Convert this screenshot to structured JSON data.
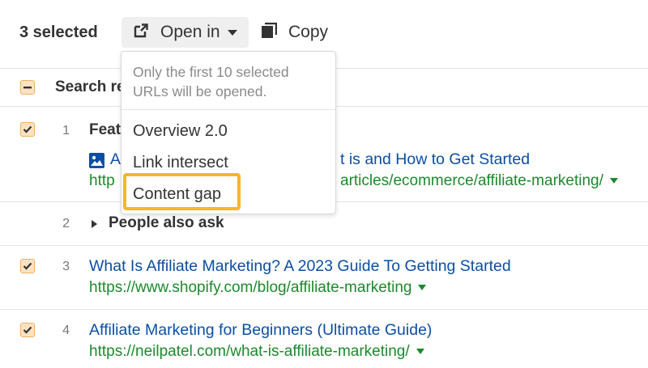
{
  "toolbar": {
    "selected_count": "3 selected",
    "open_in_label": "Open in",
    "copy_label": "Copy"
  },
  "table_header": {
    "column_label": "Search re"
  },
  "rows": [
    {
      "number": "1",
      "label": "Feat",
      "title_start": "A",
      "title_end": "t is and How to Get Started",
      "url_start": "http",
      "url_end": "articles/ecommerce/affiliate-marketing/",
      "checked": true
    },
    {
      "number": "2",
      "label": "People also ask",
      "checked": false
    },
    {
      "number": "3",
      "title": "What Is Affiliate Marketing? A 2023 Guide To Getting Started",
      "url": "https://www.shopify.com/blog/affiliate-marketing",
      "checked": true
    },
    {
      "number": "4",
      "title": "Affiliate Marketing for Beginners (Ultimate Guide)",
      "url": "https://neilpatel.com/what-is-affiliate-marketing/",
      "checked": true
    }
  ],
  "dropdown": {
    "note": "Only the first 10 selected URLs will be opened.",
    "items": [
      "Overview 2.0",
      "Link intersect",
      "Content gap"
    ],
    "highlighted": "Content gap"
  },
  "colors": {
    "checkbox_fill": "#fce2c2",
    "checkbox_border": "#f0b060",
    "link": "#0a4fa4",
    "url": "#1b8a2b",
    "highlight": "#f7b42c"
  }
}
